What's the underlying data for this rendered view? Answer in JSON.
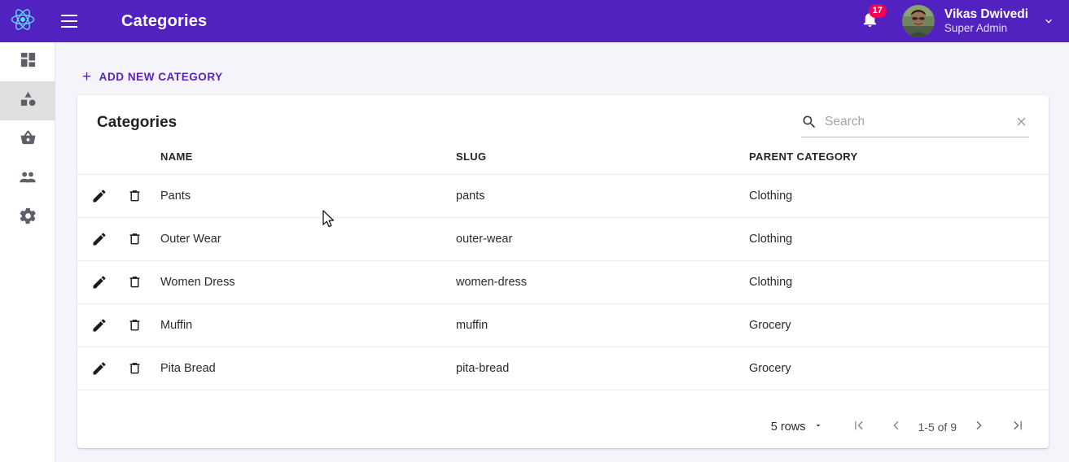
{
  "appbar": {
    "logo_icon": "react-logo-icon",
    "menu_icon": "hamburger-menu-icon",
    "title": "Categories",
    "notification_icon": "bell-icon",
    "notification_count": "17",
    "user_name": "Vikas Dwivedi",
    "user_role": "Super Admin",
    "caret_icon": "chevron-down-icon",
    "brand_color": "#5122bf",
    "badge_color": "#f50057",
    "logo_color": "#61dafb"
  },
  "sidebar": {
    "items": [
      {
        "name": "dashboard",
        "icon": "dashboard-grid-icon",
        "active": false
      },
      {
        "name": "categories",
        "icon": "category-shapes-icon",
        "active": true
      },
      {
        "name": "products",
        "icon": "basket-icon",
        "active": false
      },
      {
        "name": "users",
        "icon": "people-icon",
        "active": false
      },
      {
        "name": "settings",
        "icon": "gear-icon",
        "active": false
      }
    ],
    "active_bg": "#e0e0e0"
  },
  "toolbar": {
    "add_label": "ADD NEW CATEGORY",
    "add_icon": "plus-icon",
    "accent_color": "#5b21c0"
  },
  "card": {
    "title": "Categories"
  },
  "search": {
    "placeholder": "Search",
    "value": "",
    "search_icon": "search-icon",
    "clear_icon": "close-icon"
  },
  "table": {
    "headers": [
      "NAME",
      "SLUG",
      "PARENT CATEGORY"
    ],
    "edit_icon": "pencil-icon",
    "delete_icon": "trash-icon",
    "rows": [
      {
        "name": "Pants",
        "slug": "pants",
        "parent": "Clothing"
      },
      {
        "name": "Outer Wear",
        "slug": "outer-wear",
        "parent": "Clothing"
      },
      {
        "name": "Women Dress",
        "slug": "women-dress",
        "parent": "Clothing"
      },
      {
        "name": "Muffin",
        "slug": "muffin",
        "parent": "Grocery"
      },
      {
        "name": "Pita Bread",
        "slug": "pita-bread",
        "parent": "Grocery"
      }
    ]
  },
  "pagination": {
    "rows_per_page_label": "5 rows",
    "rows_dropdown_icon": "caret-down-icon",
    "first_icon": "first-page-icon",
    "prev_icon": "previous-page-icon",
    "range_label": "1-5 of 9",
    "next_icon": "next-page-icon",
    "last_icon": "last-page-icon"
  }
}
